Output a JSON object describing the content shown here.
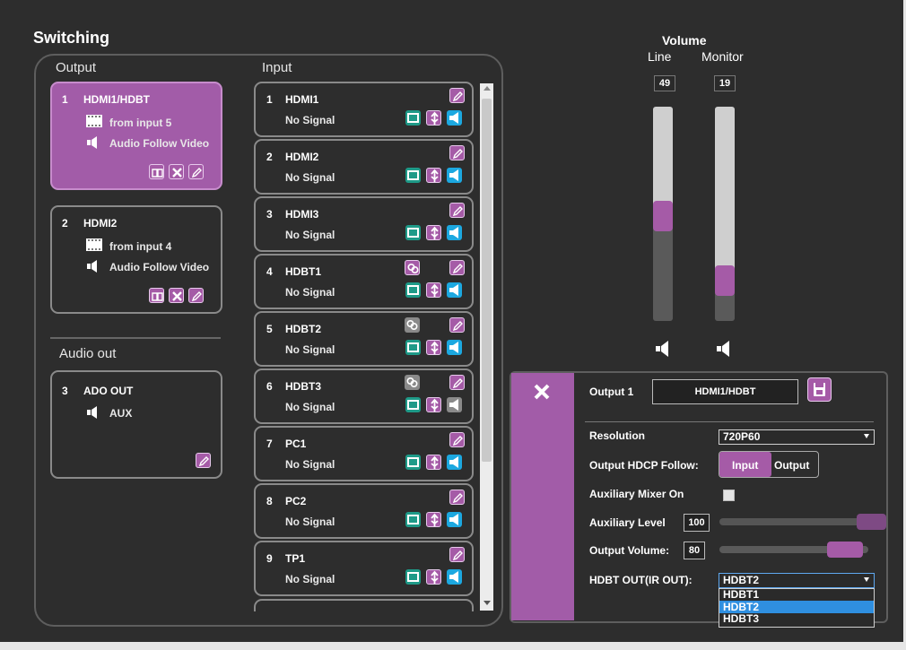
{
  "title": "Switching",
  "output_header": "Output",
  "input_header": "Input",
  "audio_out_header": "Audio out",
  "outputs": [
    {
      "num": "1",
      "name": "HDMI1/HDBT",
      "source": "from input 5",
      "audio": "Audio Follow Video",
      "selected": true
    },
    {
      "num": "2",
      "name": "HDMI2",
      "source": "from input 4",
      "audio": "Audio Follow Video",
      "selected": false
    }
  ],
  "audio_out": {
    "num": "3",
    "name": "ADO OUT",
    "audio": "AUX"
  },
  "inputs": [
    {
      "num": "1",
      "name": "HDMI1",
      "status": "No Signal",
      "link": false,
      "link_active": false,
      "audio_active": true
    },
    {
      "num": "2",
      "name": "HDMI2",
      "status": "No Signal",
      "link": false,
      "link_active": false,
      "audio_active": true
    },
    {
      "num": "3",
      "name": "HDMI3",
      "status": "No Signal",
      "link": false,
      "link_active": false,
      "audio_active": true
    },
    {
      "num": "4",
      "name": "HDBT1",
      "status": "No Signal",
      "link": true,
      "link_active": true,
      "audio_active": true
    },
    {
      "num": "5",
      "name": "HDBT2",
      "status": "No Signal",
      "link": true,
      "link_active": false,
      "audio_active": true
    },
    {
      "num": "6",
      "name": "HDBT3",
      "status": "No Signal",
      "link": true,
      "link_active": false,
      "audio_active": false
    },
    {
      "num": "7",
      "name": "PC1",
      "status": "No Signal",
      "link": false,
      "link_active": false,
      "audio_active": true
    },
    {
      "num": "8",
      "name": "PC2",
      "status": "No Signal",
      "link": false,
      "link_active": false,
      "audio_active": true
    },
    {
      "num": "9",
      "name": "TP1",
      "status": "No Signal",
      "link": false,
      "link_active": false,
      "audio_active": true
    }
  ],
  "volume": {
    "title": "Volume",
    "line_label": "Line",
    "monitor_label": "Monitor",
    "line_value": "49",
    "monitor_value": "19"
  },
  "settings": {
    "output_label": "Output 1",
    "output_name": "HDMI1/HDBT",
    "resolution_label": "Resolution",
    "resolution_value": "720P60",
    "hdcp_label": "Output HDCP Follow:",
    "hdcp_input": "Input",
    "hdcp_output": "Output",
    "aux_mixer_label": "Auxiliary Mixer On",
    "aux_mixer_checked": false,
    "aux_level_label": "Auxiliary Level",
    "aux_level_value": "100",
    "output_volume_label": "Output Volume:",
    "output_volume_value": "80",
    "hdbt_out_label": "HDBT OUT(IR OUT):",
    "hdbt_out_value": "HDBT2",
    "hdbt_options": [
      "HDBT1",
      "HDBT2",
      "HDBT3"
    ],
    "hdbt_highlighted": "HDBT2"
  },
  "colors": {
    "accent_purple": "#a55ba7",
    "video_green": "#1e9a88",
    "audio_blue": "#1ca8e0",
    "inactive_gray": "#8a8a8a",
    "highlight_blue": "#2f8fe0"
  },
  "icons": [
    "film-icon",
    "speaker-icon",
    "book-icon",
    "crossover-icon",
    "edit-icon",
    "link-icon",
    "usb-icon",
    "save-icon",
    "close-icon"
  ]
}
